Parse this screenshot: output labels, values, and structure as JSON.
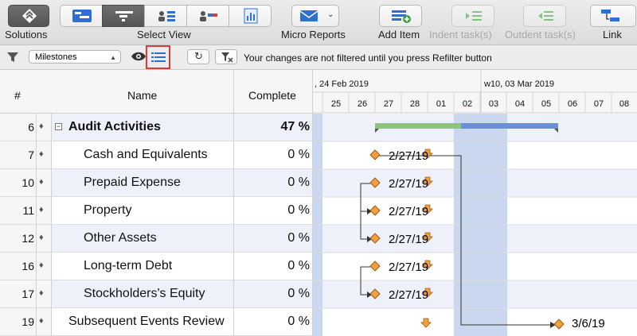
{
  "toolbar": {
    "solutions_label": "Solutions",
    "select_view_label": "Select View",
    "micro_reports_label": "Micro Reports",
    "add_item_label": "Add Item",
    "indent_label": "Indent task(s)",
    "outdent_label": "Outdent task(s)",
    "link_label": "Link"
  },
  "filterbar": {
    "filter_value": "Milestones",
    "message": "Your changes are not filtered until you press Refilter button"
  },
  "grid": {
    "col_num": "#",
    "col_name": "Name",
    "col_complete": "Complete",
    "rows": [
      {
        "num": "6",
        "name": "Audit Activities",
        "complete": "47 %"
      },
      {
        "num": "7",
        "name": "Cash and Equivalents",
        "complete": "0 %"
      },
      {
        "num": "10",
        "name": "Prepaid Expense",
        "complete": "0 %"
      },
      {
        "num": "11",
        "name": "Property",
        "complete": "0 %"
      },
      {
        "num": "12",
        "name": "Other Assets",
        "complete": "0 %"
      },
      {
        "num": "16",
        "name": "Long-term Debt",
        "complete": "0 %"
      },
      {
        "num": "17",
        "name": "Stockholders's Equity",
        "complete": "0 %"
      },
      {
        "num": "19",
        "name": "Subsequent Events Review",
        "complete": "0 %"
      }
    ]
  },
  "gantt": {
    "week1": ", 24 Feb 2019",
    "week2": "w10, 03 Mar 2019",
    "days": [
      "25",
      "26",
      "27",
      "28",
      "01",
      "02",
      "03",
      "04",
      "05",
      "06",
      "07",
      "08"
    ],
    "milestone_dates": [
      "2/27/19",
      "2/27/19",
      "2/27/19",
      "2/27/19",
      "2/27/19",
      "2/27/19",
      "3/6/19"
    ],
    "colors": {
      "summary_done": "#8cc47a",
      "summary_rest": "#6b8fd6",
      "weekend": "#c9d8ef",
      "milestone": "#f0a040"
    }
  }
}
